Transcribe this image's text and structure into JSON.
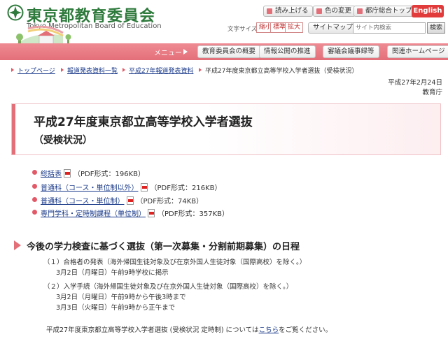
{
  "header": {
    "logo_title": "東京都教育委員会",
    "logo_sub": "Tokyo Metropolitan Board of Education",
    "read_aloud": "読み上げる",
    "color_change": "色の変更",
    "metro_top": "都庁総合トップ",
    "english": "English",
    "font_size_label": "文字サイズ",
    "font_small": "縮小",
    "font_standard": "標準",
    "font_large": "拡大",
    "sitemap": "サイトマップ",
    "search_placeholder": "サイト内検索",
    "search_button": "検索"
  },
  "menu": {
    "label": "メニュー",
    "items": [
      "教育委員会の概要",
      "情報公開の推進",
      "審議会議事録等",
      "関連ホームページ"
    ]
  },
  "breadcrumb": [
    "トップページ",
    "報道発表資料一覧",
    "平成27年報道発表資料",
    "平成27年度東京都立高等学校入学者選抜（受検状況）"
  ],
  "date": "平成27年2月24日",
  "org": "教育庁",
  "title": {
    "main": "平成27年度東京都立高等学校入学者選抜",
    "sub": "（受検状況）"
  },
  "files": [
    {
      "label": "総括表",
      "size": "（PDF形式：196KB）"
    },
    {
      "label": "普通科（コース・単位制以外）",
      "size": "（PDF形式：216KB）"
    },
    {
      "label": "普通科（コース・単位制）",
      "size": "（PDF形式：74KB）"
    },
    {
      "label": "専門学科・定時制課程（単位制）",
      "size": "（PDF形式：357KB）"
    }
  ],
  "schedule": {
    "title": "今後の学力検査に基づく選抜（第一次募集・分割前期募集）の日程",
    "item1": "（１）合格者の発表（海外帰国生徒対象及び在京外国人生徒対象（国際高校）を除く。）",
    "item1_detail": "3月2日（月曜日）午前9時学校に掲示",
    "item2": "（２）入学手続（海外帰国生徒対象及び在京外国人生徒対象（国際高校）を除く。）",
    "item2_detail1": "3月2日（月曜日）午前9時から午後3時まで",
    "item2_detail2": "3月3日（火曜日）午前9時から正午まで"
  },
  "note": {
    "before": "平成27年度東京都立高等学校入学者選抜 (受検状況 定時制) については",
    "link": "こちら",
    "after": "をご覧ください。"
  },
  "colors": {
    "brand_green": "#2e7a3c",
    "menu_pink": "#e36f79",
    "english_red": "#e23b3b",
    "link_blue": "#1a3a8a"
  }
}
